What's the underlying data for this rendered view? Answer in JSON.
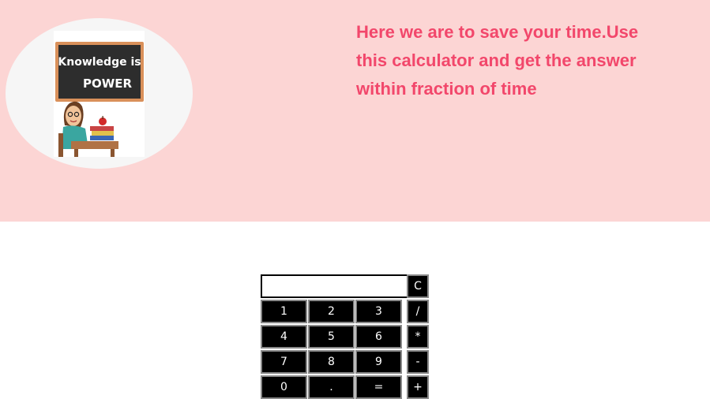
{
  "hero": {
    "image_text_line1": "Knowledge is",
    "image_text_line2": "POWER",
    "tagline": "Here we are to save your time.Use this calculator and get the answer within fraction of time"
  },
  "calculator": {
    "display_value": "",
    "keys": {
      "clear": "C",
      "one": "1",
      "two": "2",
      "three": "3",
      "divide": "/",
      "four": "4",
      "five": "5",
      "six": "6",
      "multiply": "*",
      "seven": "7",
      "eight": "8",
      "nine": "9",
      "subtract": "-",
      "zero": "0",
      "dot": ".",
      "equals": "=",
      "add": "+"
    }
  }
}
